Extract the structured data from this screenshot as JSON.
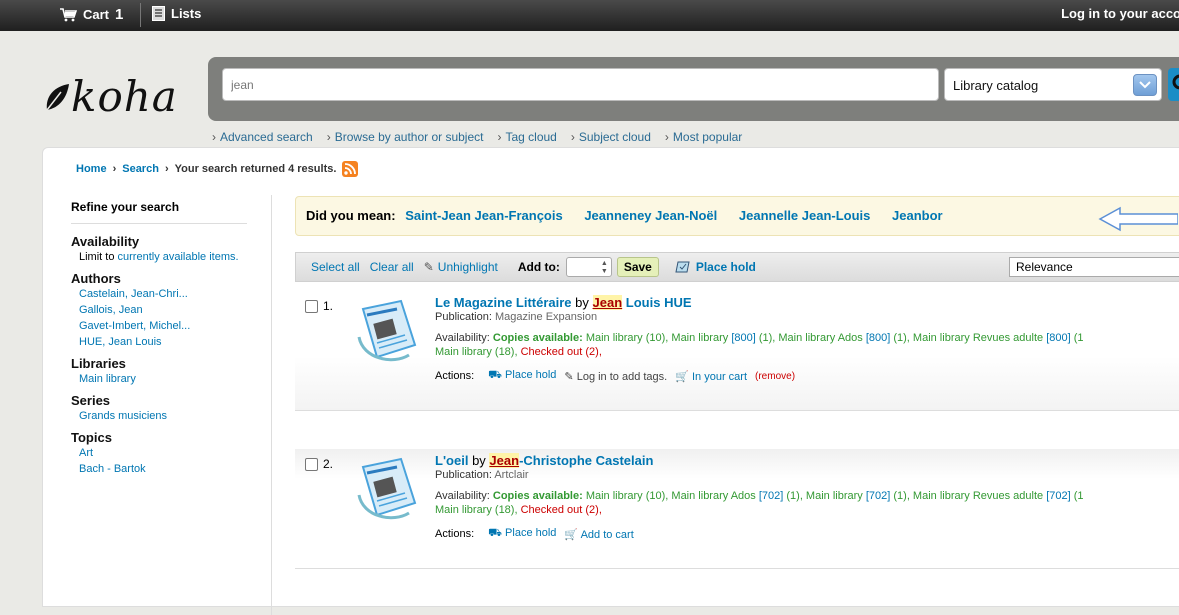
{
  "topbar": {
    "cart_label": "Cart",
    "cart_count": "1",
    "lists_label": "Lists",
    "login_label": "Log in to your acco"
  },
  "logo": {
    "text": "koha"
  },
  "search": {
    "query": "jean",
    "catalog": "Library catalog"
  },
  "subnav": [
    "Advanced search",
    "Browse by author or subject",
    "Tag cloud",
    "Subject cloud",
    "Most popular"
  ],
  "breadcrumb": {
    "home": "Home",
    "search": "Search",
    "current": "Your search returned 4 results."
  },
  "sidebar": {
    "refine": "Refine your search",
    "availability": {
      "heading": "Availability",
      "text": "Limit to ",
      "link": "currently available items."
    },
    "authors": {
      "heading": "Authors",
      "items": [
        "Castelain, Jean-Chri...",
        "Gallois, Jean",
        "Gavet-Imbert, Michel...",
        "HUE, Jean Louis"
      ]
    },
    "libraries": {
      "heading": "Libraries",
      "items": [
        "Main library"
      ]
    },
    "series": {
      "heading": "Series",
      "items": [
        "Grands musiciens"
      ]
    },
    "topics": {
      "heading": "Topics",
      "items": [
        "Art",
        "Bach - Bartok"
      ]
    }
  },
  "didyoumean": {
    "label": "Did you mean:",
    "items": [
      "Saint-Jean Jean-François",
      "Jeanneney Jean-Noël",
      "Jeannelle Jean-Louis",
      "Jeanbor"
    ]
  },
  "toolbar": {
    "select_all": "Select all",
    "clear_all": "Clear all",
    "unhighlight": "Unhighlight",
    "add_to": "Add to:",
    "save": "Save",
    "place_hold": "Place hold",
    "sort": "Relevance"
  },
  "results": [
    {
      "num": "1.",
      "title": "Le Magazine Littéraire",
      "by": "by",
      "author_hl": "Jean",
      "author_rest": "Louis HUE",
      "pub_label": "Publication:",
      "pub": "Magazine Expansion",
      "avail_label": "Availability:",
      "copies_label": "Copies available:",
      "avail_line1": "Main library (10), Main library ",
      "avail_line1_code1": "[800]",
      "avail_line1_mid1": " (1), Main library Ados ",
      "avail_line1_code2": "[800]",
      "avail_line1_mid2": " (1), Main library Revues adulte ",
      "avail_line1_code3": "[800]",
      "avail_line1_end": " (1",
      "avail_line2": "Main library (18), ",
      "checked_out": "Checked out (2),",
      "actions_label": "Actions:",
      "place_hold": "Place hold",
      "tags": "Log in to add tags.",
      "cart": "In your cart",
      "remove": "(remove)"
    },
    {
      "num": "2.",
      "title": "L'oeil",
      "by": "by",
      "author_hl": "Jean",
      "author_rest": "-Christophe Castelain",
      "pub_label": "Publication:",
      "pub": "Artclair",
      "avail_label": "Availability:",
      "copies_label": "Copies available:",
      "avail_line1": "Main library (10), Main library Ados ",
      "avail_line1_code1": "[702]",
      "avail_line1_mid1": " (1), Main library ",
      "avail_line1_code2": "[702]",
      "avail_line1_mid2": " (1), Main library Revues adulte ",
      "avail_line1_code3": "[702]",
      "avail_line1_end": " (1",
      "avail_line2": "Main library (18), ",
      "checked_out": "Checked out (2),",
      "actions_label": "Actions:",
      "place_hold": "Place hold",
      "cart": "Add to cart"
    }
  ],
  "colors": {
    "link": "#0076b2",
    "topbar": "#2a2a2a",
    "available": "#339933",
    "checked_out": "#cc0000"
  }
}
